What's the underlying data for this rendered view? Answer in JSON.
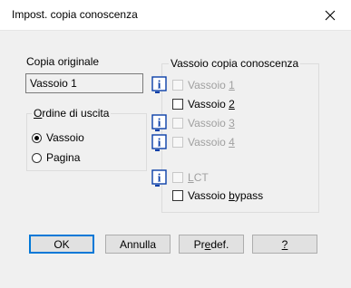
{
  "window": {
    "title": "Impost. copia conoscenza"
  },
  "original": {
    "label": "Copia originale",
    "value": "Vassoio 1"
  },
  "output_order": {
    "legend": "Ordine di uscita",
    "options": [
      {
        "label": "Vassoio",
        "selected": true
      },
      {
        "label": "Pagina",
        "selected": false
      }
    ]
  },
  "cc_tray": {
    "legend": "Vassoio copia conoscenza",
    "items": [
      {
        "label": "Vassoio 1",
        "enabled": false,
        "checked": false,
        "info": true
      },
      {
        "label": "Vassoio 2",
        "enabled": true,
        "checked": false,
        "info": false
      },
      {
        "label": "Vassoio 3",
        "enabled": false,
        "checked": false,
        "info": true
      },
      {
        "label": "Vassoio 4",
        "enabled": false,
        "checked": false,
        "info": true
      },
      {
        "label": "LCT",
        "enabled": false,
        "checked": false,
        "info": true
      },
      {
        "label": "Vassoio bypass",
        "enabled": true,
        "checked": false,
        "info": false
      }
    ]
  },
  "buttons": {
    "ok": "OK",
    "cancel": "Annulla",
    "default": "Predef.",
    "help": "?"
  },
  "colors": {
    "accent": "#0078d7",
    "info_blue": "#0a3fa8"
  },
  "icons": {
    "info": "info-icon",
    "close": "close-icon"
  }
}
